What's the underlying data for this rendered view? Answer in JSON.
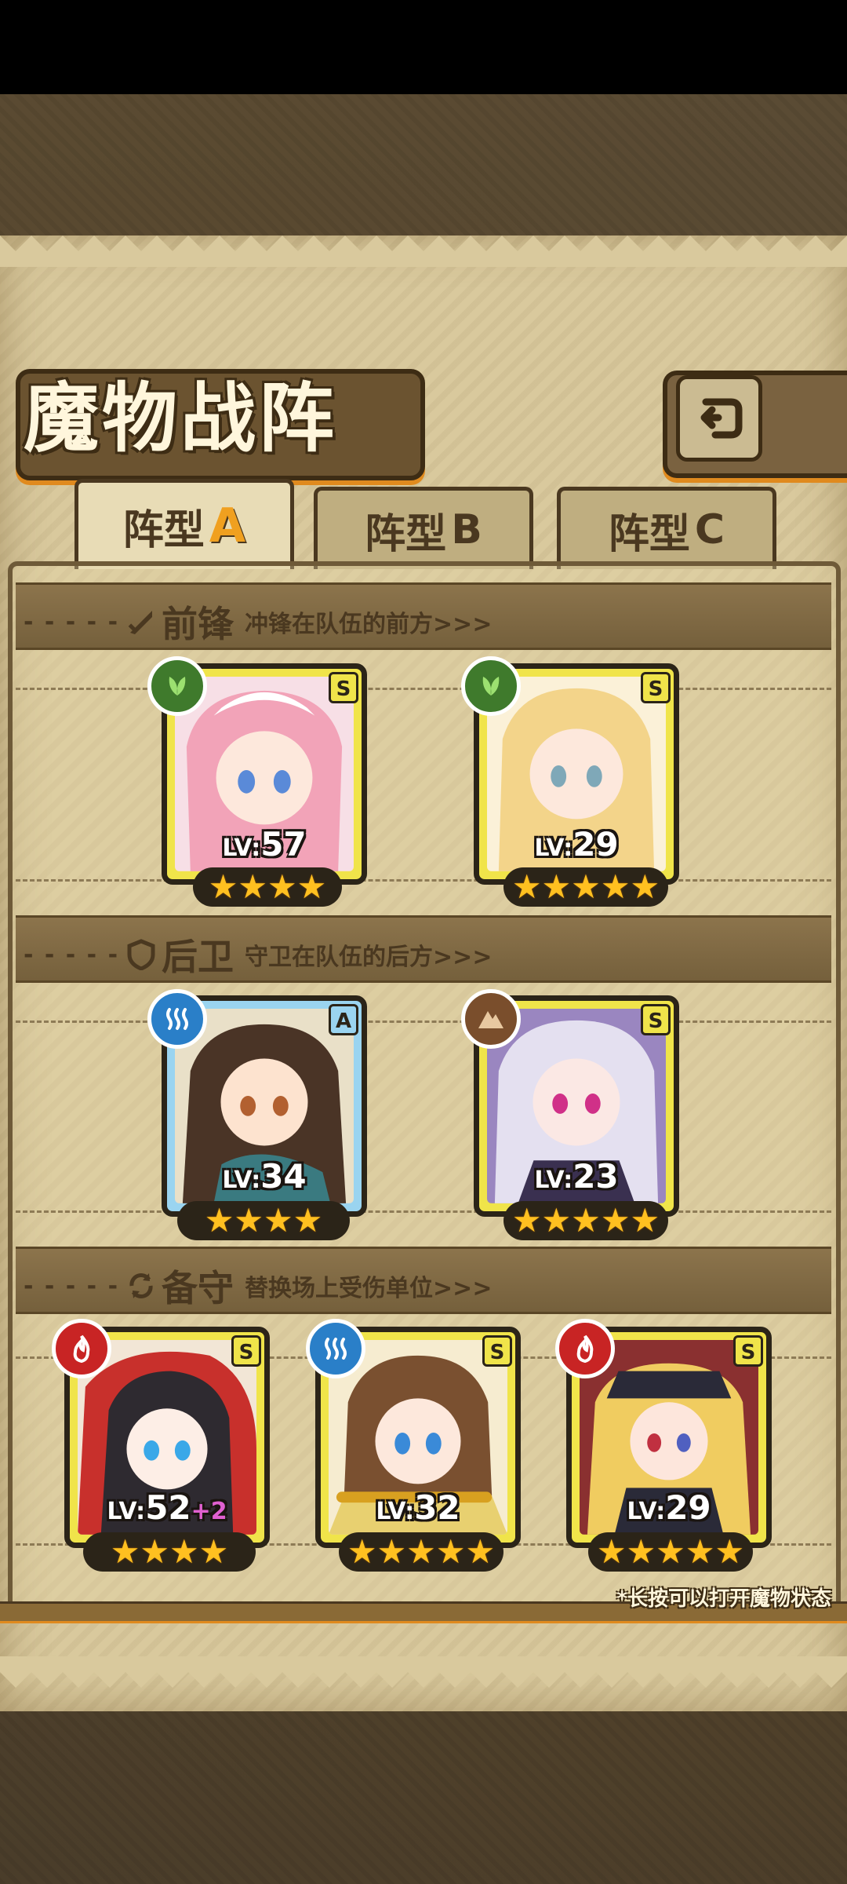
{
  "screen": {
    "title": "魔物战阵",
    "back_icon": "back-arrow-icon",
    "tabs": [
      {
        "label": "阵型",
        "letter": "A",
        "active": true
      },
      {
        "label": "阵型",
        "letter": "B",
        "active": false
      },
      {
        "label": "阵型",
        "letter": "C",
        "active": false
      }
    ],
    "footnote": "*长按可以打开魔物状态"
  },
  "sections": {
    "vanguard": {
      "name": "前锋",
      "desc": "冲锋在队伍的前方>>>",
      "icon": "sword-icon"
    },
    "rearguard": {
      "name": "后卫",
      "desc": "守卫在队伍的后方>>>",
      "icon": "shield-icon"
    },
    "reserve": {
      "name": "备守",
      "desc": "替换场上受伤单位>>>",
      "icon": "swap-icon"
    }
  },
  "monsters": {
    "vanguard": [
      {
        "level": "57",
        "rank": "S",
        "element": "nature",
        "stars": "★★★★",
        "hair": "#f2a3b8"
      },
      {
        "level": "29",
        "rank": "S",
        "element": "nature",
        "stars": "★★★★★",
        "hair": "#f3d48a"
      }
    ],
    "rearguard": [
      {
        "level": "34",
        "rank": "A",
        "element": "water",
        "stars": "★★★★",
        "hair": "#4a3426"
      },
      {
        "level": "23",
        "rank": "S",
        "element": "earth",
        "stars": "★★★★★",
        "hair": "#e4e0f0"
      }
    ],
    "reserve": [
      {
        "level": "52",
        "bonus": "+2",
        "rank": "S",
        "element": "fire",
        "stars": "★★★★",
        "hair": "#2e2a30"
      },
      {
        "level": "32",
        "rank": "S",
        "element": "water",
        "stars": "★★★★★",
        "hair": "#7a5030"
      },
      {
        "level": "29",
        "rank": "S",
        "element": "fire",
        "stars": "★★★★★",
        "hair": "#f0cc60"
      }
    ]
  },
  "labels": {
    "lv_prefix": "LV:"
  },
  "colors": {
    "accent": "#e08a1e",
    "parchment": "#d9c99d",
    "card_s": "#f0e44a",
    "card_a": "#9ad4f0"
  }
}
